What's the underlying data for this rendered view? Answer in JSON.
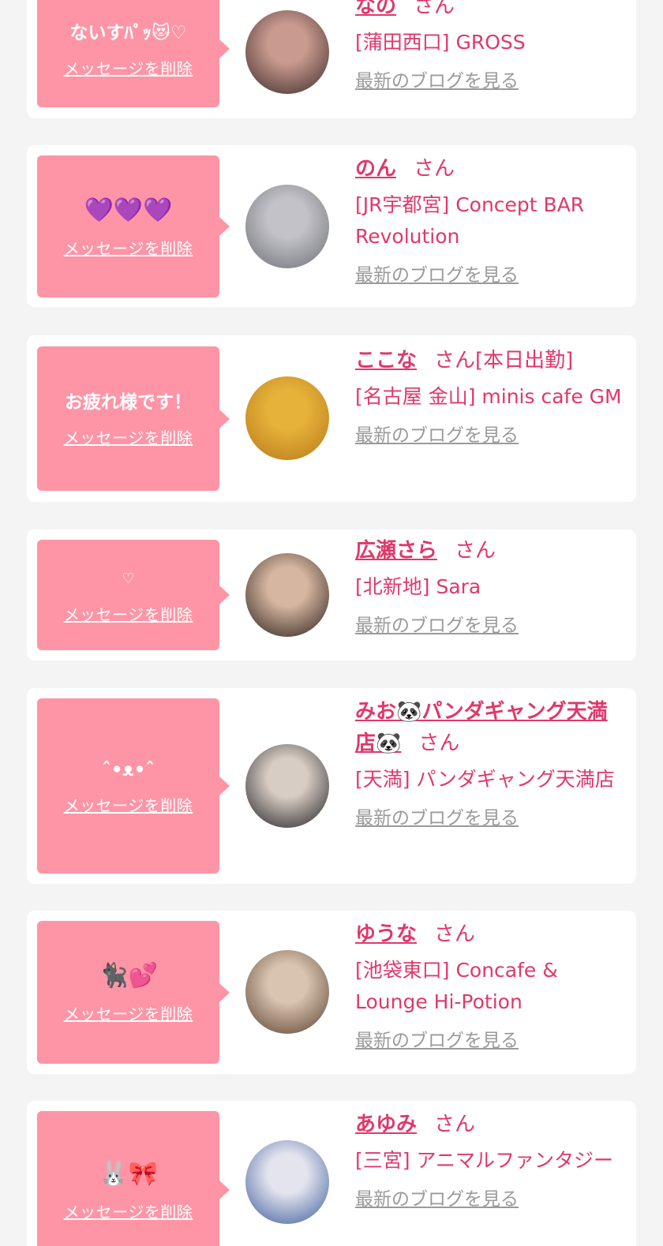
{
  "messages": [
    {
      "message": "ないすﾊﾟｯ😻♡",
      "delete_label": "メッセージを削除",
      "name": "なの",
      "honorific": "さん",
      "extra": "",
      "shop": "[蒲田西口] GROSS",
      "blog_label": "最新のブログを見る",
      "avatar_icon": "avatar-photo-icon",
      "avatar_colors": [
        "#3b2a2a",
        "#c99a8e"
      ]
    },
    {
      "message": "💜💜💜",
      "delete_label": "メッセージを削除",
      "name": "のん",
      "honorific": "さん",
      "extra": "",
      "shop": "[JR宇都宮] Concept BAR Revolution",
      "blog_label": "最新のブログを見る",
      "avatar_icon": "avatar-photo-icon",
      "avatar_colors": [
        "#6e6e76",
        "#c2c2c8"
      ]
    },
    {
      "message": "お疲れ様です！",
      "delete_label": "メッセージを削除",
      "name": "ここな",
      "honorific": "さん",
      "extra": "[本日出勤]",
      "shop": "[名古屋 金山] minis cafe GM",
      "blog_label": "最新のブログを見る",
      "avatar_icon": "avatar-photo-icon",
      "avatar_colors": [
        "#b8781a",
        "#e6b23a"
      ]
    },
    {
      "message": "♡",
      "delete_label": "メッセージを削除",
      "name": "広瀬さら",
      "honorific": "さん",
      "extra": "",
      "shop": "[北新地] Sara",
      "blog_label": "最新のブログを見る",
      "avatar_icon": "avatar-photo-icon",
      "avatar_colors": [
        "#2a1e1a",
        "#d6b6a0"
      ]
    },
    {
      "message": "ˆ•ᴥ•ˆ",
      "delete_label": "メッセージを削除",
      "name": "みお🐼パンダギャング天満店🐼",
      "honorific": "さん",
      "extra": "",
      "shop": "[天満] パンダギャング天満店",
      "blog_label": "最新のブログを見る",
      "avatar_icon": "avatar-photo-icon",
      "avatar_colors": [
        "#1e1e22",
        "#d8cdc4"
      ]
    },
    {
      "message": "🐈‍⬛💕",
      "delete_label": "メッセージを削除",
      "name": "ゆうな",
      "honorific": "さん",
      "extra": "",
      "shop": "[池袋東口] Concafe & Lounge Hi-Potion",
      "blog_label": "最新のブログを見る",
      "avatar_icon": "avatar-photo-icon",
      "avatar_colors": [
        "#5a4030",
        "#d8c4b0"
      ]
    },
    {
      "message": "🐰🎀",
      "delete_label": "メッセージを削除",
      "name": "あゆみ",
      "honorific": "さん",
      "extra": "",
      "shop": "[三宮] アニマルファンタジー",
      "blog_label": "最新のブログを見る",
      "avatar_icon": "avatar-photo-icon",
      "avatar_colors": [
        "#3a5a9a",
        "#e4e4ee"
      ]
    }
  ]
}
